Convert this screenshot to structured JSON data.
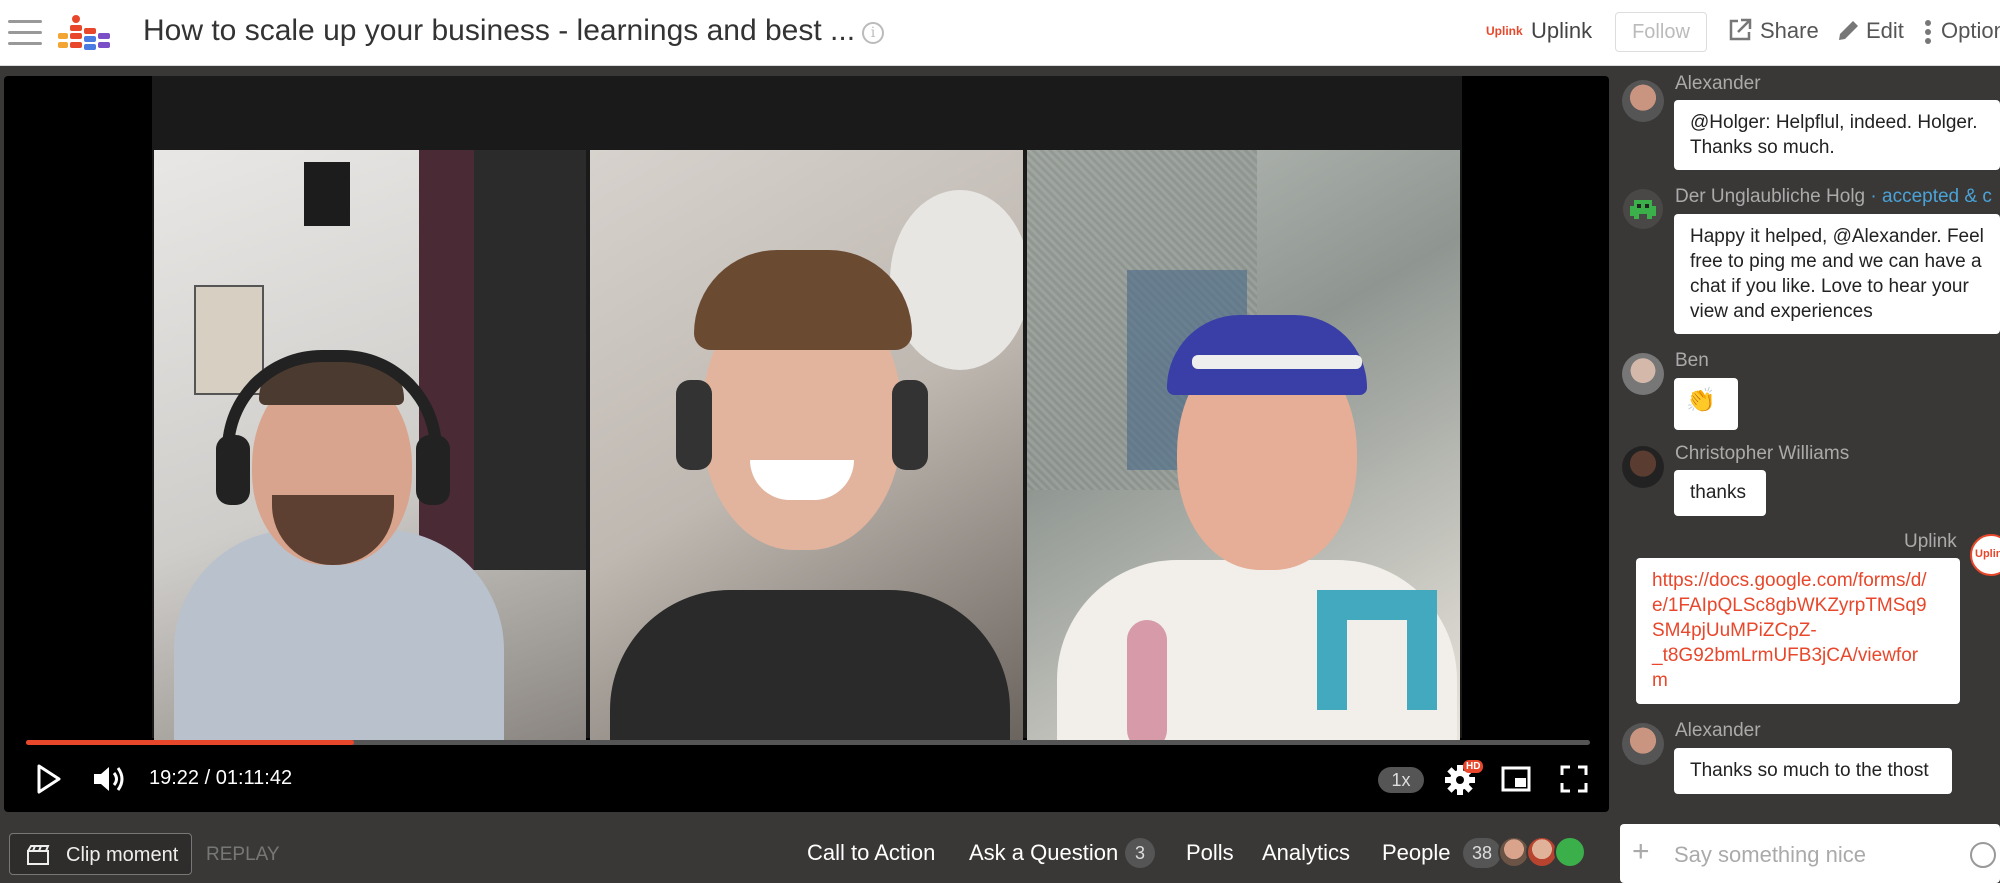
{
  "header": {
    "title": "How to scale up your business - learnings and best ...",
    "host_badge": "Uplink",
    "host_name": "Uplink",
    "follow_label": "Follow",
    "share_label": "Share",
    "edit_label": "Edit",
    "options_label": "Options"
  },
  "player": {
    "time": "19:22 / 01:11:42",
    "speed": "1x",
    "hd": "HD",
    "progress_fraction": 0.21
  },
  "bottom_bar": {
    "clip_label": "Clip moment",
    "replay_label": "REPLAY",
    "cta_label": "Call to Action",
    "ask_label": "Ask a Question",
    "ask_count": "3",
    "polls_label": "Polls",
    "analytics_label": "Analytics",
    "people_label": "People",
    "people_count": "38"
  },
  "chat": {
    "messages": [
      {
        "author": "Alexander",
        "lines": [
          "@Holger: Helpflul, indeed. Holger.",
          "Thanks so much."
        ]
      },
      {
        "author": "Der Unglaubliche Holg",
        "status": "· accepted & c",
        "lines": [
          "Happy it helped, @Alexander. Feel",
          "free to ping me and we can have a",
          "chat if you like. Love to hear your",
          "view and experiences"
        ]
      },
      {
        "author": "Ben",
        "lines": [
          "👏"
        ]
      },
      {
        "author": "Christopher Williams",
        "lines": [
          "thanks"
        ]
      },
      {
        "author": "Uplink",
        "avatar_text": "Uplin",
        "lines": [
          "https://docs.google.com/forms/d/",
          "e/1FAIpQLSc8gbWKZyrpTMSq9",
          "SM4pjUuMPiZCpZ-",
          "_t8G92bmLrmUFB3jCA/viewfor",
          "m"
        ]
      },
      {
        "author": "Alexander",
        "lines": [
          "Thanks so much to the thost"
        ]
      }
    ],
    "input_placeholder": "Say something nice"
  },
  "colors": {
    "accent": "#e8472b",
    "chat_bg": "#3a3836",
    "link_blue": "#4aa3d8"
  }
}
